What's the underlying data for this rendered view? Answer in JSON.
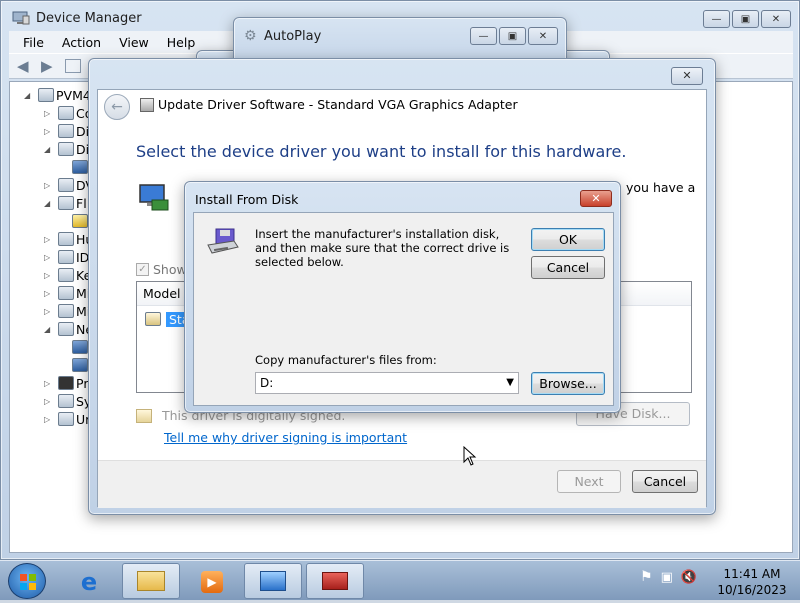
{
  "device_manager": {
    "title": "Device Manager",
    "menu": [
      "File",
      "Action",
      "View",
      "Help"
    ],
    "tree": {
      "root": "PVM4",
      "rows": [
        "Co",
        "Di",
        "Di",
        "",
        "DV",
        "Fl",
        "",
        "Hu",
        "ID",
        "Ke",
        "Mi",
        "Mi",
        "Ne",
        "",
        "",
        "Pr",
        "Sy",
        "Ur"
      ]
    }
  },
  "autoplay": {
    "title": "AutoPlay"
  },
  "update_driver": {
    "title": "Update Driver Software - Standard VGA Graphics Adapter",
    "heading": "Select the device driver you want to install for this hardware.",
    "instruction_tail": "you have a",
    "show_compatible": "Show",
    "list_header": "Model",
    "list_item": "Stan",
    "signed_text": "This driver is digitally signed.",
    "have_disk": "Have Disk...",
    "link": "Tell me why driver signing is important",
    "next": "Next",
    "cancel": "Cancel"
  },
  "install_from_disk": {
    "title": "Install From Disk",
    "message": "Insert the manufacturer's installation disk, and then make sure that the correct drive is selected below.",
    "ok": "OK",
    "cancel": "Cancel",
    "copy_label": "Copy manufacturer's files from:",
    "path_value": "D:",
    "browse": "Browse..."
  },
  "taskbar": {
    "time": "11:41 AM",
    "date": "10/16/2023"
  }
}
